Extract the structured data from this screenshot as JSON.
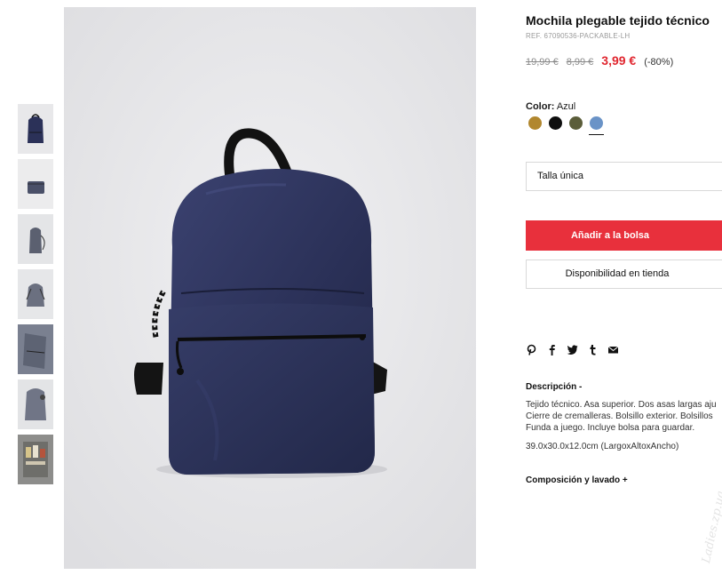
{
  "product": {
    "title": "Mochila plegable tejido técnico",
    "ref": "REF. 67090536-PACKABLE-LH",
    "old_price_1": "19,99 €",
    "old_price_2": "8,99 €",
    "current_price": "3,99 €",
    "discount": "(-80%)"
  },
  "color": {
    "label": "Color:",
    "selected_name": "Azul",
    "swatches": [
      {
        "name": "mustard",
        "hex": "#b1872e"
      },
      {
        "name": "black",
        "hex": "#0e0e0e"
      },
      {
        "name": "olive",
        "hex": "#5b5d3a"
      },
      {
        "name": "blue",
        "hex": "#6a93c7",
        "selected": true
      }
    ]
  },
  "size": {
    "label": "Talla única"
  },
  "actions": {
    "add_to_bag": "Añadir a la bolsa",
    "store_availability": "Disponibilidad en tienda"
  },
  "share_icons": [
    "pinterest-icon",
    "facebook-icon",
    "twitter-icon",
    "tumblr-icon",
    "email-icon"
  ],
  "description": {
    "title": "Descripción -",
    "lines": [
      "Tejido técnico. Asa superior. Dos asas largas aju",
      "Cierre de cremalleras. Bolsillo exterior. Bolsillos",
      "Funda a juego. Incluye bolsa para guardar."
    ],
    "dimensions": "39.0x30.0x12.0cm (LargoxAltoxAncho)"
  },
  "composition": {
    "title": "Composición y lavado +"
  },
  "watermark": "Ladies.zp.ua",
  "colors": {
    "accent_red": "#e8303c",
    "price_red": "#e0262f",
    "bag_navy": "#2b3158"
  }
}
